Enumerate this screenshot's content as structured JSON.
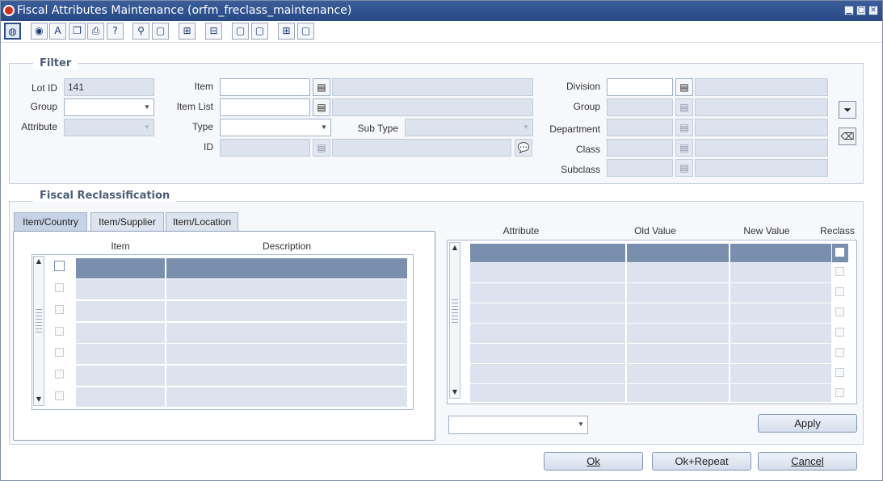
{
  "window": {
    "title": "Fiscal Attributes Maintenance  (orfm_freclass_maintenance)",
    "controls": [
      "minimize-icon",
      "maximize-icon",
      "close-icon"
    ]
  },
  "toolbar": {
    "icons": [
      "globe-icon",
      "help-circle-icon",
      "spellcheck-icon",
      "copy-icon",
      "print-icon",
      "question-icon",
      "find-icon",
      "new-record-icon",
      "tree-icon",
      "tree-add-icon",
      "new-doc-icon",
      "new-doc-2-icon",
      "tree-expand-icon",
      "new-doc-3-icon"
    ]
  },
  "filter": {
    "title": "Filter",
    "lot_id_label": "Lot ID",
    "lot_id_value": "141",
    "group_label": "Group",
    "attribute_label": "Attribute",
    "item_label": "Item",
    "item_list_label": "Item List",
    "type_label": "Type",
    "sub_type_label": "Sub Type",
    "id_label": "ID",
    "division_label": "Division",
    "group2_label": "Group",
    "department_label": "Department",
    "class_label": "Class",
    "subclass_label": "Subclass"
  },
  "reclass": {
    "title": "Fiscal Reclassification",
    "tabs": [
      "Item/Country",
      "Item/Supplier",
      "Item/Location"
    ],
    "left_headers": [
      "Item",
      "Description"
    ],
    "right_headers": [
      "Attribute",
      "Old Value",
      "New Value",
      "Reclass"
    ],
    "apply_label": "Apply"
  },
  "footer": {
    "ok_label": "Ok",
    "ok_repeat_label": "Ok+Repeat",
    "cancel_label": "Cancel"
  }
}
